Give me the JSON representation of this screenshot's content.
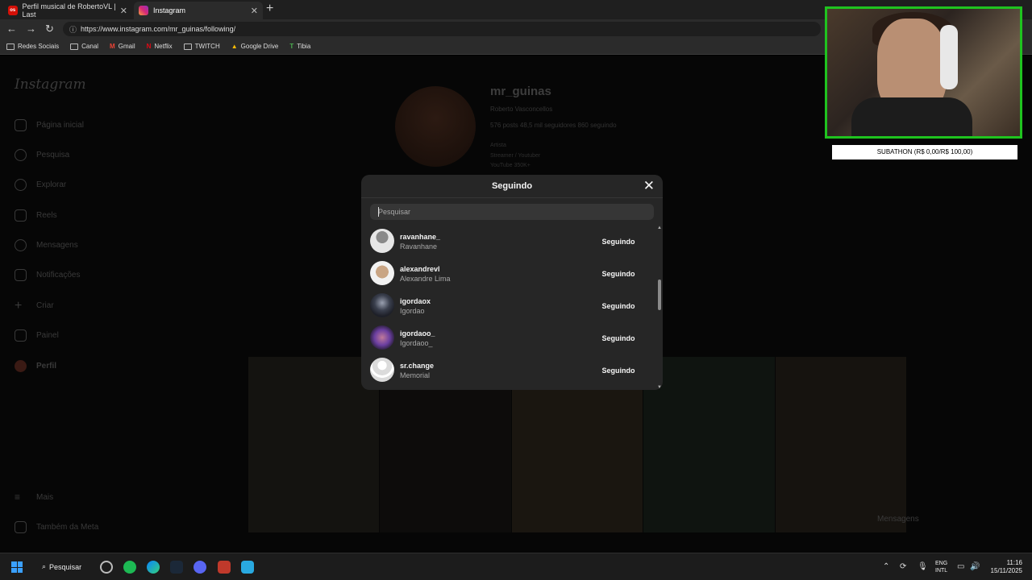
{
  "browser": {
    "tabs": [
      {
        "label": "Perfil musical de RobertoVL | Last",
        "favicon": "lastfm-icon"
      },
      {
        "label": "Instagram",
        "favicon": "instagram-icon"
      }
    ],
    "url": "https://www.instagram.com/mr_guinas/following/",
    "bookmarks": [
      {
        "label": "Redes Sociais"
      },
      {
        "label": "Canal"
      },
      {
        "label": "Gmail"
      },
      {
        "label": "Netflix"
      },
      {
        "label": "TWITCH"
      },
      {
        "label": "Google Drive"
      },
      {
        "label": "Tibia"
      }
    ]
  },
  "instagram": {
    "logo": "Instagram",
    "nav": [
      {
        "label": "Página inicial"
      },
      {
        "label": "Pesquisa"
      },
      {
        "label": "Explorar"
      },
      {
        "label": "Reels"
      },
      {
        "label": "Mensagens"
      },
      {
        "label": "Notificações"
      },
      {
        "label": "Criar"
      },
      {
        "label": "Painel"
      },
      {
        "label": "Perfil"
      },
      {
        "label": "Mais"
      },
      {
        "label": "Também da Meta"
      }
    ],
    "profile": {
      "username": "mr_guinas",
      "fullname": "Roberto Vasconcellos",
      "stats": "576 posts   48,5 mil seguidores   860 seguindo",
      "bio1": "Artista",
      "bio2": "Streamer / Youtuber",
      "bio3": "YouTube 350K+"
    },
    "messages_float": "Mensagens"
  },
  "modal": {
    "title": "Seguindo",
    "search_placeholder": "Pesquisar",
    "following": [
      {
        "username": "ravanhane_",
        "name": "Ravanhane",
        "button": "Seguindo",
        "avatar_color": "#d9d9d9"
      },
      {
        "username": "alexandrevl",
        "name": "Alexandre Lima",
        "button": "Seguindo",
        "avatar_color": "#c9a584"
      },
      {
        "username": "igordaox",
        "name": "Igordao",
        "button": "Seguindo",
        "avatar_color": "#3a3f4d"
      },
      {
        "username": "igordaoo_",
        "name": "Igordaoo_",
        "button": "Seguindo",
        "avatar_color": "#6b3fa0"
      },
      {
        "username": "sr.change",
        "name": "Memorial",
        "button": "Seguindo",
        "avatar_color": "#dbdbdb"
      }
    ]
  },
  "overlay": {
    "subathon": "SUBATHON (R$ 0,00/R$ 100,00)",
    "webcam_border_color": "#1fc31f"
  },
  "taskbar": {
    "search_label": "Pesquisar",
    "lang_line1": "ENG",
    "lang_line2": "INTL",
    "time": "11:16",
    "date": "15/11/2025"
  }
}
